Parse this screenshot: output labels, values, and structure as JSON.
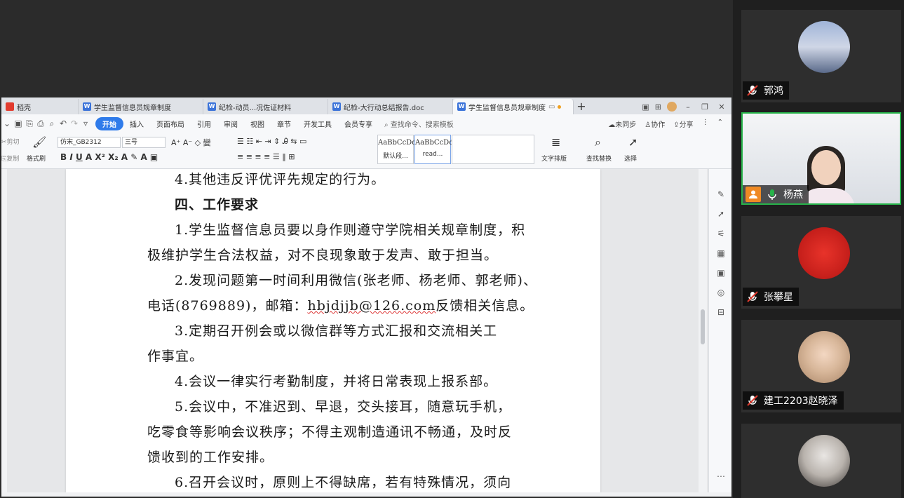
{
  "tabs": [
    {
      "label": "稻壳",
      "icon": "daoke-icon"
    },
    {
      "label": "学生监督信息员规章制度",
      "icon": "doc-icon"
    },
    {
      "label": "纪检-动员...况佐证材料",
      "icon": "doc-icon"
    },
    {
      "label": "纪检-大行动总结报告.doc",
      "icon": "doc-icon"
    },
    {
      "label": "学生监督信息员规章制度",
      "icon": "doc-icon",
      "active": true
    }
  ],
  "menu": {
    "items": [
      "开始",
      "插入",
      "页面布局",
      "引用",
      "审阅",
      "视图",
      "章节",
      "开发工具",
      "会员专享"
    ],
    "search": "查找命令、搜索模板",
    "right": [
      "未同步",
      "协作",
      "分享"
    ]
  },
  "ribbon": {
    "cut": "剪切",
    "copy": "复制",
    "format_painter": "格式刷",
    "font_name": "仿宋_GB2312",
    "font_size": "三号",
    "style1_sample": "AaBbCcDd",
    "style1_name": "默认段...",
    "style2_sample": "AaBbCcDd",
    "style2_name": "read...",
    "text_layout": "文字排版",
    "find_replace": "查找替换",
    "select": "选择"
  },
  "document": {
    "lines": [
      "4.其他违反评优评先规定的行为。",
      "四、工作要求",
      "1.学生监督信息员要以身作则遵守学院相关规章制度，积",
      "极维护学生合法权益，对不良现象敢于发声、敢于担当。",
      "2.发现问题第一时间利用微信(张老师、杨老师、郭老师)、",
      "电话(8769889)，邮箱：",
      "hbjdjjb@126.com",
      "反馈相关信息。",
      "3.定期召开例会或以微信群等方式汇报和交流相关工",
      "作事宜。",
      "4.会议一律实行考勤制度，并将日常表现上报系部。",
      "5.会议中，不准迟到、早退，交头接耳，随意玩手机，",
      "吃零食等影响会议秩序；不得主观制造通讯不畅通，及时反",
      "馈收到的工作安排。",
      "6.召开会议时，原则上不得缺席，若有特殊情况，须向"
    ]
  },
  "participants": [
    {
      "name": "郭鸿",
      "muted": true
    },
    {
      "name": "杨燕",
      "muted": false,
      "host": true,
      "speaking": true
    },
    {
      "name": "张攀星",
      "muted": true
    },
    {
      "name": "建工2203赵晓泽",
      "muted": true
    },
    {
      "name": "",
      "muted": false
    }
  ],
  "colors": {
    "accent": "#2f7bea",
    "active_border": "#27b34a",
    "host_badge": "#f08a24",
    "mute_red": "#e23b2e"
  }
}
